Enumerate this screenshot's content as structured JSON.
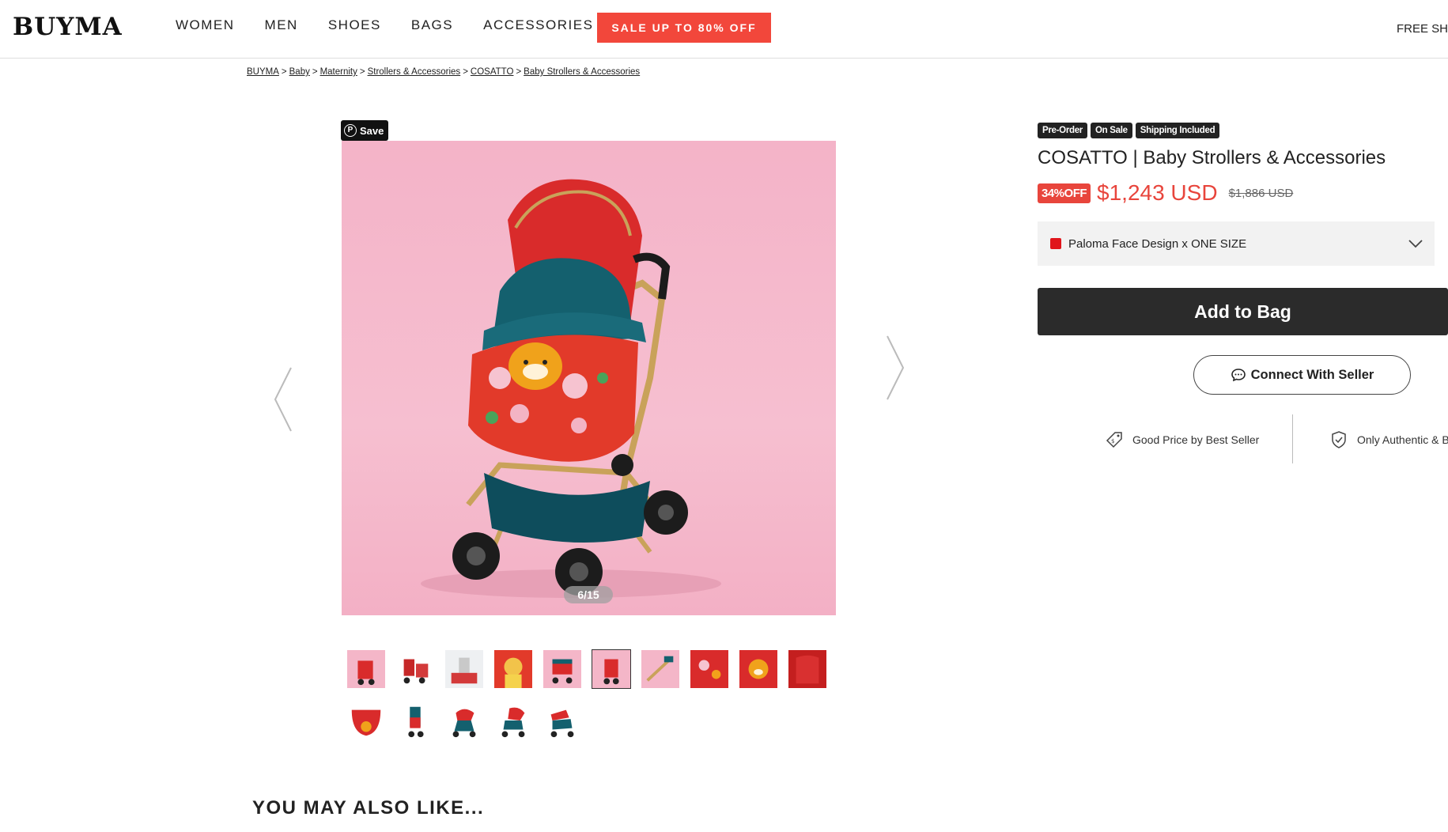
{
  "header": {
    "logo": "BUYMA",
    "nav": [
      "WOMEN",
      "MEN",
      "SHOES",
      "BAGS",
      "ACCESSORIES"
    ],
    "sale_label": "SALE UP TO 80% OFF",
    "free_ship": "FREE SHIP"
  },
  "breadcrumb": [
    "BUYMA",
    "Baby",
    "Maternity",
    "Strollers & Accessories",
    "COSATTO",
    "Baby Strollers & Accessories"
  ],
  "gallery": {
    "save_label": "Save",
    "counter": "6/15",
    "current_index": 6,
    "total": 15
  },
  "product": {
    "badges": [
      "Pre-Order",
      "On Sale",
      "Shipping Included"
    ],
    "title": "COSATTO | Baby Strollers & Accessories",
    "discount": "34%OFF",
    "price": "$1,243 USD",
    "original_price": "$1,886 USD",
    "variant": "Paloma Face Design x ONE SIZE",
    "variant_color": "#e0151b",
    "add_to_bag": "Add to Bag",
    "connect_seller": "Connect With Seller"
  },
  "perks": [
    {
      "icon": "price-tag-icon",
      "label": "Good Price by Best Seller"
    },
    {
      "icon": "shield-check-icon",
      "label": "Only Authentic & B"
    }
  ],
  "recommendations": {
    "heading": "YOU MAY ALSO LIKE..."
  },
  "colors": {
    "accent": "#f2473b",
    "price": "#e8453c",
    "dark": "#2b2b2b"
  }
}
